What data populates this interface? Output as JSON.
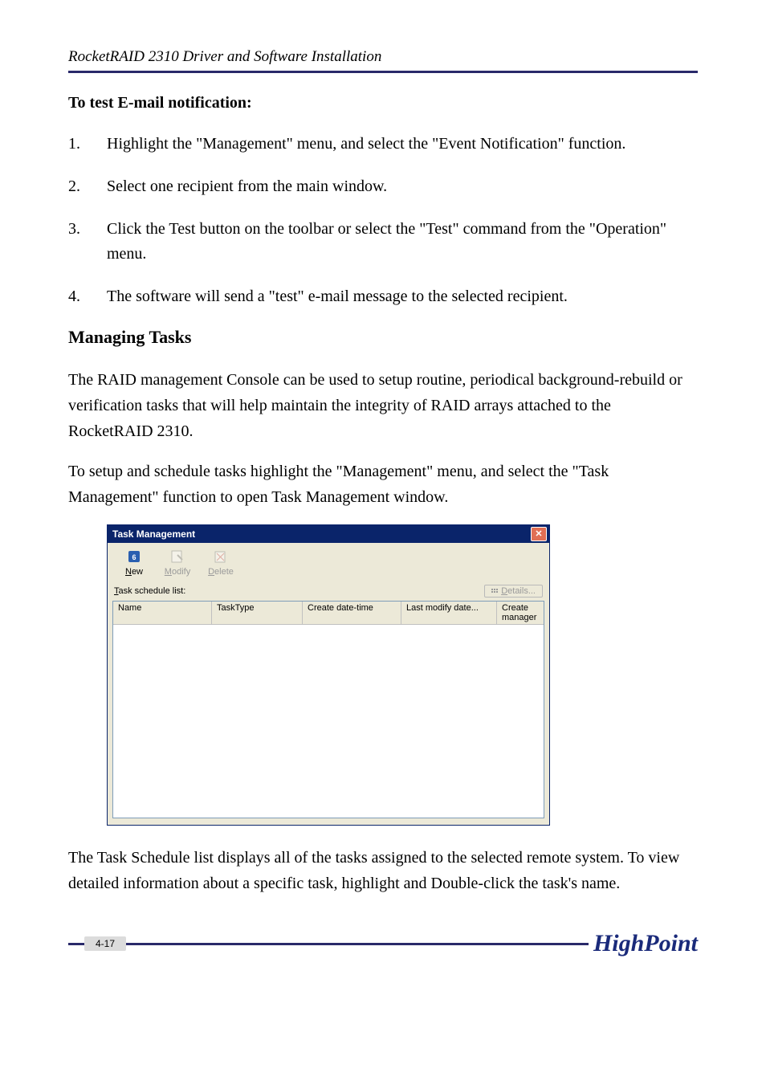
{
  "header": {
    "running_title": "RocketRAID 2310 Driver and Software Installation"
  },
  "section1_heading": "To test E-mail notification:",
  "steps": [
    {
      "n": "1.",
      "t": "Highlight the \"Management\" menu, and select the \"Event Notification\" function."
    },
    {
      "n": "2.",
      "t": "Select one recipient from the main window."
    },
    {
      "n": "3.",
      "t": "Click the Test button on the toolbar or select the \"Test\" command from the \"Operation\" menu."
    },
    {
      "n": "4.",
      "t": "The software will send a \"test\" e-mail message to the selected recipient."
    }
  ],
  "section2_heading": "Managing Tasks",
  "para1": "The RAID management Console can be used to setup routine, periodical background-rebuild or verification tasks that will help maintain the integrity of RAID arrays attached to the RocketRAID 2310.",
  "para2": "To setup and schedule tasks highlight the \"Management\" menu, and select the \"Task Management\" function to open Task Management window.",
  "window": {
    "title": "Task Management",
    "toolbar": {
      "new": "New",
      "modify": "Modify",
      "delete": "Delete"
    },
    "list_label": "Task schedule list:",
    "details_label": "Details...",
    "columns": {
      "c1": "Name",
      "c2": "TaskType",
      "c3": "Create date-time",
      "c4": "Last modify date...",
      "c5": "Create manager"
    }
  },
  "para3": "The Task Schedule list displays all of the tasks assigned to the selected remote system.  To view detailed information about a specific task, highlight and Double-click the task's name.",
  "footer": {
    "page": "4-17",
    "brand": "HighPoint"
  }
}
